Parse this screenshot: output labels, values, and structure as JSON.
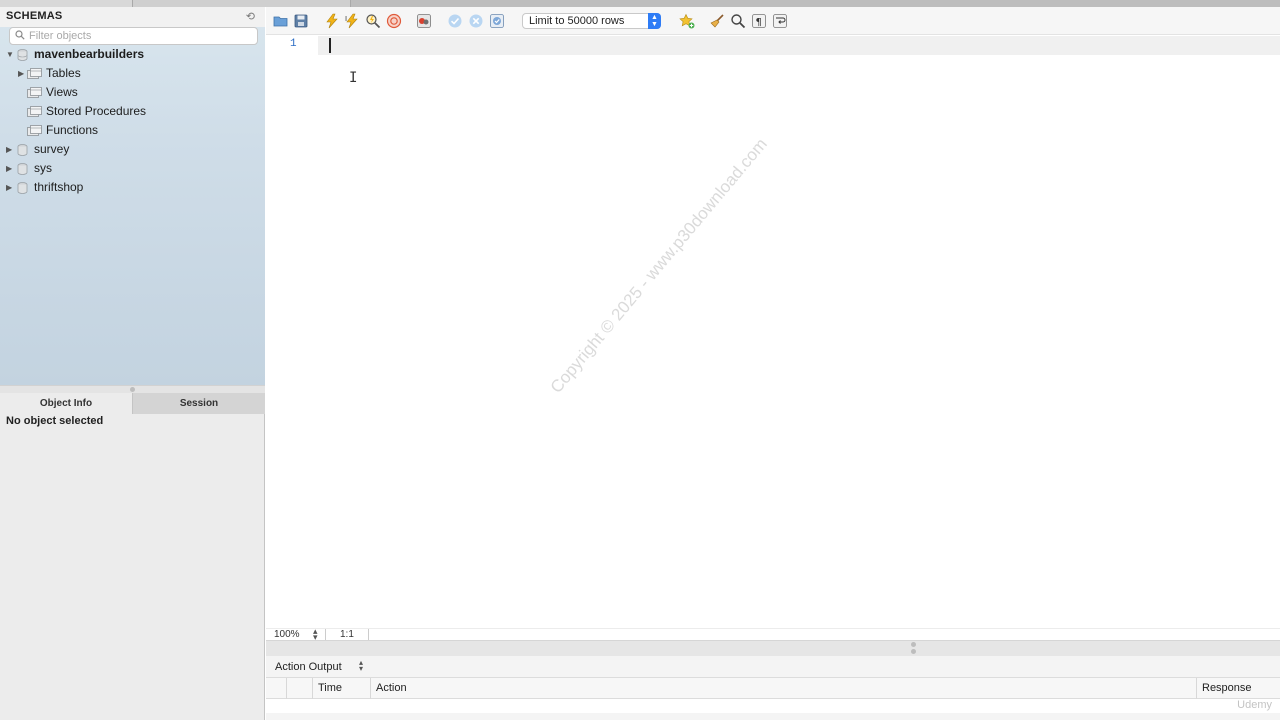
{
  "sidebar": {
    "title": "SCHEMAS",
    "filter_placeholder": "Filter objects",
    "schemas": [
      {
        "name": "mavenbearbuilders",
        "expanded": true,
        "children": [
          "Tables",
          "Views",
          "Stored Procedures",
          "Functions"
        ]
      },
      {
        "name": "survey",
        "expanded": false
      },
      {
        "name": "sys",
        "expanded": false
      },
      {
        "name": "thriftshop",
        "expanded": false
      }
    ],
    "info_tabs": [
      "Object Info",
      "Session"
    ],
    "info_message": "No object selected"
  },
  "toolbar": {
    "limit_label": "Limit to 50000 rows"
  },
  "editor": {
    "line_number": "1",
    "watermark": "Copyright © 2025 - www.p30download.com"
  },
  "status": {
    "zoom": "100%",
    "cursor_position": "1:1"
  },
  "output": {
    "selector_label": "Action Output",
    "columns": [
      "Time",
      "Action",
      "Response"
    ]
  },
  "branding": {
    "udemy": "Udemy"
  },
  "colors": {
    "accent": "#2e7cf6",
    "sidebar_gradient": "#cfdde8",
    "line_number": "#2b6cc4"
  }
}
